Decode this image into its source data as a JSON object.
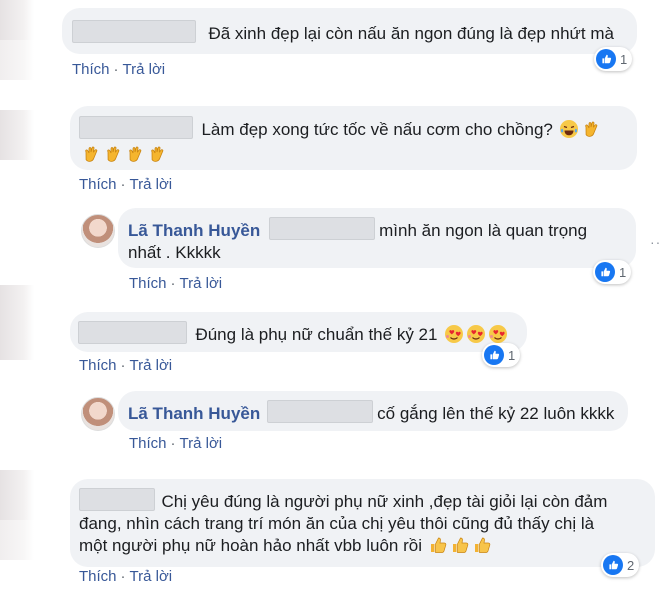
{
  "actions": {
    "like": "Thích",
    "reply": "Trả lời"
  },
  "icons": {
    "like": "like-icon",
    "reply_avatar": "user-avatar",
    "more": "more-options-icon"
  },
  "comments": [
    {
      "text": "Đã xinh đẹp lại còn nấu ăn ngon đúng là đẹp nhứt mà",
      "reactions": "1"
    },
    {
      "text": "Làm đẹp xong tức tốc về nấu cơm cho chồng?"
    },
    {
      "name": "Lã Thanh Huyền",
      "text_line1": "mình ăn ngon là quan trọng",
      "text_line2": "nhất . Kkkkk",
      "reactions": "1"
    },
    {
      "text": "Đúng là phụ nữ chuẩn thế kỷ 21",
      "reactions": "1"
    },
    {
      "name": "Lã Thanh Huyền",
      "text": "cố gắng lên thế kỷ 22 luôn kkkk"
    },
    {
      "text_line1": "Chị yêu đúng là người phụ nữ xinh ,đẹp tài giỏi lại còn đảm",
      "text_line2": "đang, nhìn cách trang trí món ăn của chị yêu thôi cũng đủ thấy chị là",
      "text_line3": "một người phụ nữ hoàn hảo nhất vbb luôn rồi",
      "reactions": "2"
    }
  ]
}
